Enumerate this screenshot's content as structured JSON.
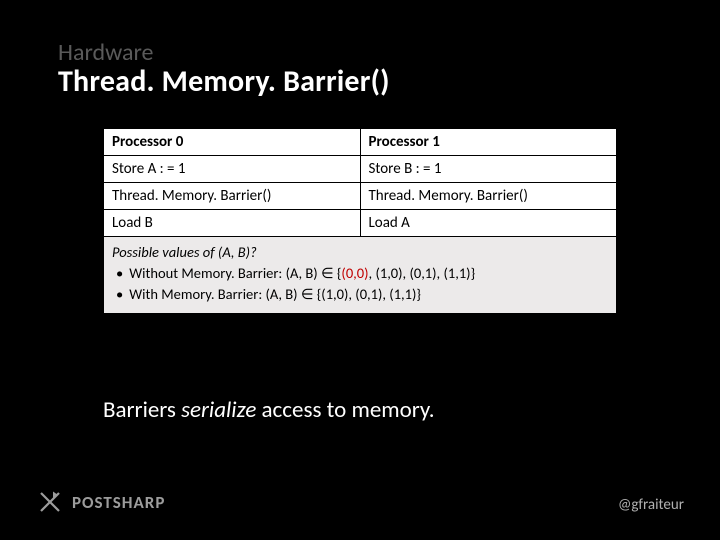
{
  "pretitle": "Hardware",
  "title": "Thread. Memory. Barrier()",
  "table": {
    "headers": [
      "Processor 0",
      "Processor 1"
    ],
    "rows": [
      [
        "Store A : = 1",
        "Store B : = 1"
      ],
      [
        "Thread. Memory. Barrier()",
        "Thread. Memory. Barrier()"
      ],
      [
        "Load B",
        "Load A"
      ]
    ]
  },
  "possible": {
    "question": "Possible values of (A, B)?",
    "items": [
      {
        "prefix": "Without Memory. Barrier: (A, B) ∈ {",
        "red": "(0,0)",
        "suffix": ", (1,0), (0,1), (1,1)}"
      },
      {
        "prefix": "With Memory. Barrier: (A, B) ∈ {(1,0), (0,1), (1,1)}",
        "red": "",
        "suffix": ""
      }
    ]
  },
  "tagline_a": "Barriers ",
  "tagline_em": "serialize",
  "tagline_b": "  access to memory.",
  "logo_text": "POSTSHARP",
  "handle": "@gfraiteur"
}
